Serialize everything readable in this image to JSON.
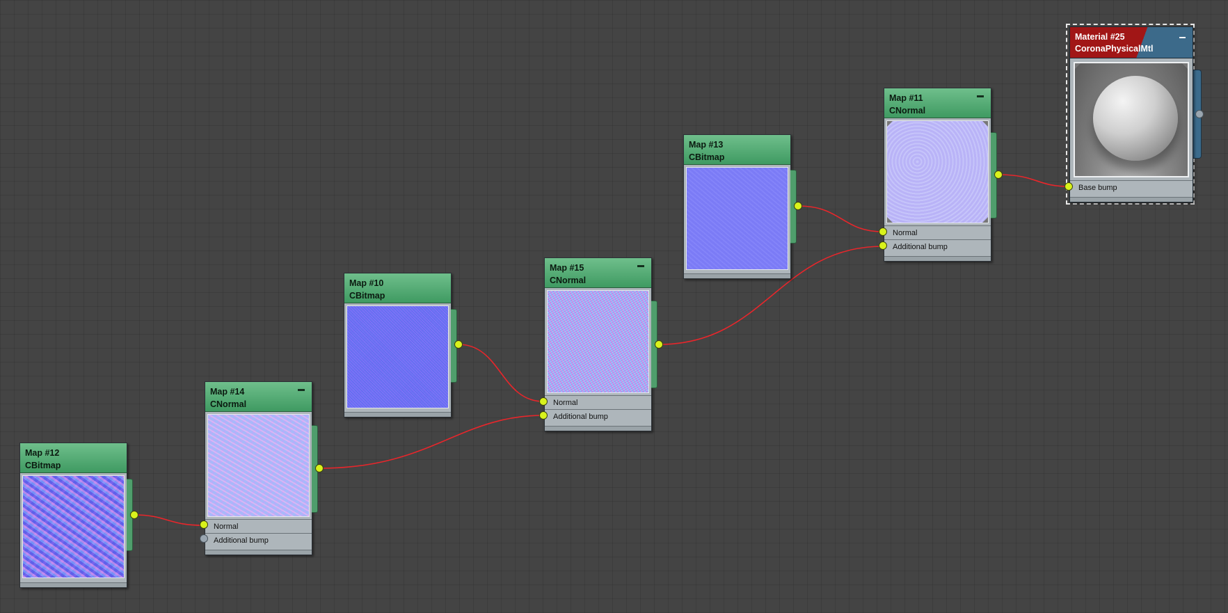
{
  "colors": {
    "canvas": "#444444",
    "wire": "#e8262b",
    "port_active": "#d9f21c",
    "port_inactive": "#9aa6b0",
    "map_header": "#4faa6f",
    "material_header": "#a11616",
    "node_body": "#aeb6bb"
  },
  "nodes": {
    "map12": {
      "title": "Map #12",
      "type": "CBitmap"
    },
    "map14": {
      "title": "Map #14",
      "type": "CNormal",
      "slots": [
        "Normal",
        "Additional bump"
      ]
    },
    "map10": {
      "title": "Map #10",
      "type": "CBitmap"
    },
    "map15": {
      "title": "Map #15",
      "type": "CNormal",
      "slots": [
        "Normal",
        "Additional bump"
      ]
    },
    "map13": {
      "title": "Map #13",
      "type": "CBitmap"
    },
    "map11": {
      "title": "Map #11",
      "type": "CNormal",
      "slots": [
        "Normal",
        "Additional bump"
      ]
    },
    "material25": {
      "title": "Material #25",
      "type": "CoronaPhysicalMtl",
      "slots": [
        "Base bump"
      ]
    }
  },
  "connections": [
    {
      "from": "Map #12",
      "to": "Map #14",
      "slot": "Normal"
    },
    {
      "from": "Map #14",
      "to": "Map #15",
      "slot": "Additional bump"
    },
    {
      "from": "Map #10",
      "to": "Map #15",
      "slot": "Normal"
    },
    {
      "from": "Map #15",
      "to": "Map #11",
      "slot": "Additional bump"
    },
    {
      "from": "Map #13",
      "to": "Map #11",
      "slot": "Normal"
    },
    {
      "from": "Map #11",
      "to": "Material #25",
      "slot": "Base bump"
    }
  ]
}
